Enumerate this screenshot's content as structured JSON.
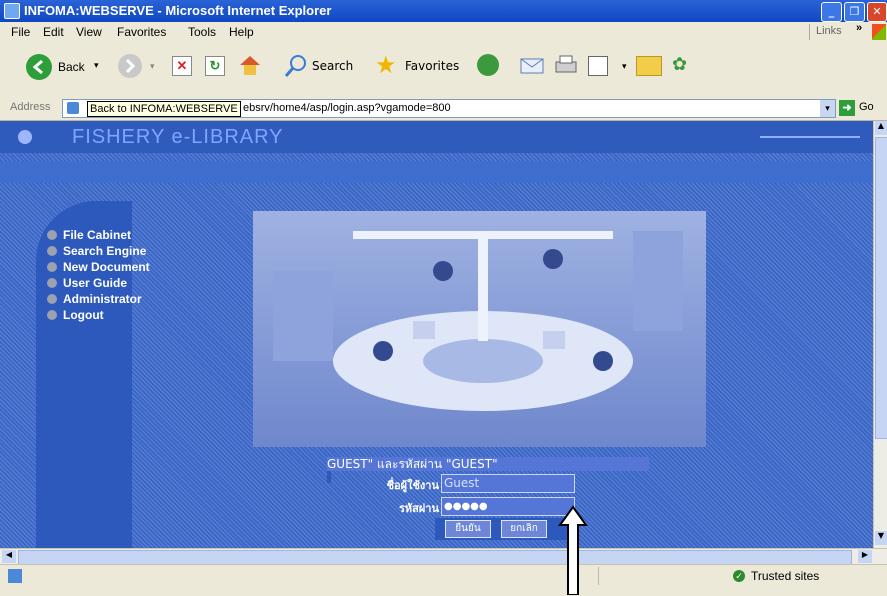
{
  "window": {
    "title": "INFOMA:WEBSERVE - Microsoft Internet Explorer",
    "min": "_",
    "max": "❐",
    "close": "✕"
  },
  "menu": {
    "items": [
      "File",
      "Edit",
      "View",
      "Favorites",
      "Tools",
      "Help"
    ],
    "links": "Links"
  },
  "toolbar": {
    "back": "Back",
    "search": "Search",
    "favorites": "Favorites"
  },
  "address": {
    "label": "Address",
    "url": "ebsrv/home4/asp/login.asp?vgamode=800",
    "tooltip": "Back to INFOMA:WEBSERVE",
    "go": "Go"
  },
  "site": {
    "logo": "FISHERY e-LIBRARY",
    "menu": [
      "File Cabinet",
      "Search Engine",
      "New Document",
      "User Guide",
      "Administrator",
      "Logout"
    ],
    "login": {
      "hint": "GUEST\" และรหัสผ่าน \"GUEST\"",
      "username_label": "ชื่อผู้ใช้งาน",
      "username_value": "Guest",
      "password_label": "รหัสผ่าน",
      "password_value": "●●●●●",
      "submit": "ยืนยัน",
      "cancel": "ยกเลิก"
    }
  },
  "status": {
    "zone": "Trusted sites"
  }
}
